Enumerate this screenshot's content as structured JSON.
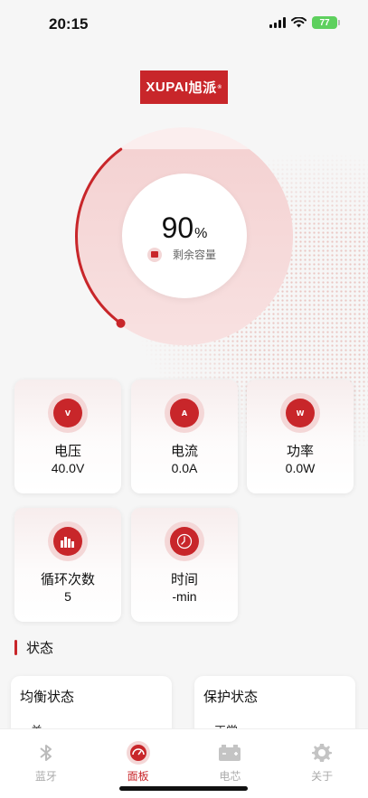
{
  "status_bar": {
    "time": "20:15",
    "battery": "77"
  },
  "logo": {
    "text_latin": "XUPAI",
    "text_cn": "旭派",
    "mark": "®"
  },
  "capacity": {
    "value": "90",
    "unit": "%",
    "label": "剩余容量",
    "percent": 90
  },
  "metrics": [
    {
      "title": "电压",
      "value": "40.0V",
      "icon": "voltmeter-icon",
      "icon_letter": "V"
    },
    {
      "title": "电流",
      "value": "0.0A",
      "icon": "ammeter-icon",
      "icon_letter": "A"
    },
    {
      "title": "功率",
      "value": "0.0W",
      "icon": "wattmeter-icon",
      "icon_letter": "W"
    },
    {
      "title": "循环次数",
      "value": "5",
      "icon": "bar-chart-icon"
    },
    {
      "title": "时间",
      "value": "-min",
      "icon": "clock-icon"
    }
  ],
  "status_section": {
    "title": "状态",
    "cards": [
      {
        "title": "均衡状态",
        "value": "关"
      },
      {
        "title": "保护状态",
        "value": "正常"
      }
    ]
  },
  "tabbar": {
    "items": [
      {
        "label": "蓝牙",
        "icon": "bluetooth-icon",
        "active": false
      },
      {
        "label": "面板",
        "icon": "dashboard-icon",
        "active": true
      },
      {
        "label": "电芯",
        "icon": "battery-cell-icon",
        "active": false
      },
      {
        "label": "关于",
        "icon": "gear-icon",
        "active": false
      }
    ]
  },
  "colors": {
    "accent": "#c8262a",
    "gauge_fill": "#f1c9c9",
    "background": "#f6f6f6"
  }
}
